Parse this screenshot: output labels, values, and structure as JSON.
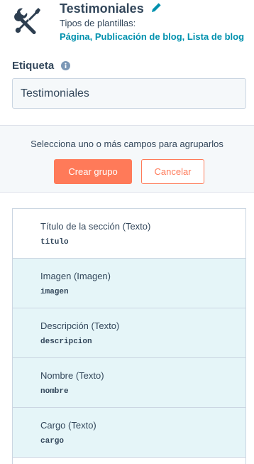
{
  "header": {
    "module_icon": "tools-icon",
    "title": "Testimoniales",
    "edit_icon": "pencil-icon",
    "template_types_label": "Tipos de plantillas:",
    "template_types": "Página, Publicación de blog, Lista de blog"
  },
  "label_field": {
    "label": "Etiqueta",
    "info_icon": "info-icon",
    "value": "Testimoniales"
  },
  "group_panel": {
    "help_text": "Selecciona uno o más campos para agruparlos",
    "create_button": "Crear grupo",
    "cancel_button": "Cancelar"
  },
  "fields": [
    {
      "label": "Título de la sección (Texto)",
      "name": "titulo",
      "selected": false
    },
    {
      "label": "Imagen (Imagen)",
      "name": "imagen",
      "selected": true
    },
    {
      "label": "Descripción (Texto)",
      "name": "descripcion",
      "selected": true
    },
    {
      "label": "Nombre (Texto)",
      "name": "nombre",
      "selected": true
    },
    {
      "label": "Cargo (Texto)",
      "name": "cargo",
      "selected": true
    }
  ],
  "colors": {
    "accent": "#ff7a59",
    "link": "#0091ae",
    "text": "#33475b",
    "selected_row": "#e5f5f8",
    "panel_bg": "#f5f8fa"
  }
}
